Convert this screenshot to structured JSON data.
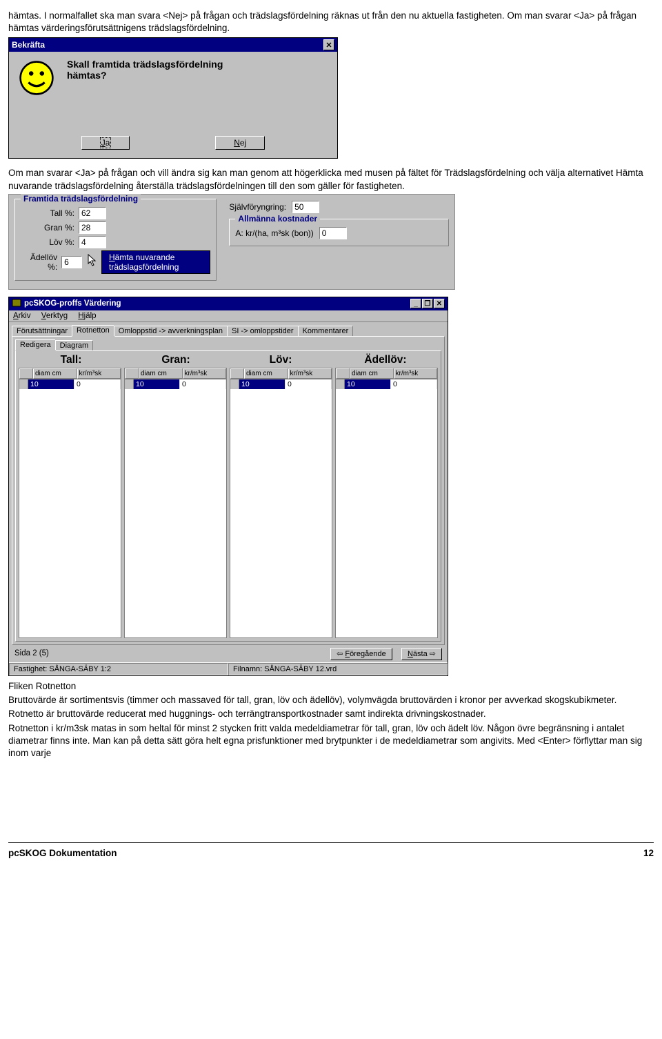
{
  "para1": "hämtas. I normalfallet ska man svara <Nej> på frågan och trädslagsfördelning räknas ut från den nu aktuella fastigheten. Om man svarar <Ja> på frågan hämtas värderingsförutsättnigens trädslagsfördelning.",
  "dialog1": {
    "title": "Bekräfta",
    "message1": "Skall framtida trädslagsfördelning",
    "message2": "hämtas?",
    "yes": "Ja",
    "no": "Nej"
  },
  "para2": "Om man svarar <Ja> på frågan och vill ändra sig kan man genom att högerklicka med musen på fältet för Trädslagsfördelning och välja alternativet Hämta nuvarande trädslagsfördelning återställa trädslagsfördelningen till den som gäller för fastigheten.",
  "form": {
    "group1_title": "Framtida trädslagsfördelning",
    "tall_lbl": "Tall %:",
    "tall_val": "62",
    "gran_lbl": "Gran %:",
    "gran_val": "28",
    "lov_lbl": "Löv %:",
    "lov_val": "4",
    "adel_lbl": "Ädellöv %:",
    "adel_val": "6",
    "sjalv_lbl": "Självföryngring:",
    "sjalv_val": "50",
    "group2_title": "Allmänna kostnader",
    "kost_lbl": "A: kr/(ha, m³sk (bon))",
    "kost_val": "0",
    "ctxmenu": "Hämta nuvarande trädslagsfördelning"
  },
  "bigwin": {
    "title": "pcSKOG-proffs Värdering",
    "menu_arkiv": "Arkiv",
    "menu_verktyg": "Verktyg",
    "menu_hjalp": "Hjälp",
    "tabs1": [
      "Förutsättningar",
      "Rotnetton",
      "Omloppstid -> avverkningsplan",
      "SI -> omloppstider",
      "Kommentarer"
    ],
    "tabs2": [
      "Redigera",
      "Diagram"
    ],
    "cols": [
      "Tall:",
      "Gran:",
      "Löv:",
      "Ädellöv:"
    ],
    "th_diam": "diam cm",
    "th_kr": "kr/m³sk",
    "rows": [
      [
        "10",
        "0"
      ],
      [
        "10",
        "0"
      ],
      [
        "10",
        "0"
      ],
      [
        "10",
        "0"
      ]
    ],
    "page": "Sida 2 (5)",
    "prev": "Föregående",
    "next": "Nästa",
    "status1": "Fastighet: SÅNGA-SÄBY 1:2",
    "status2": "Filnamn: SÅNGA-SÄBY 12.vrd"
  },
  "para3_head": "Fliken Rotnetton",
  "para3_a": "Bruttovärde är sortimentsvis (timmer och massaved för tall, gran, löv och ädellöv), volymvägda bruttovärden i kronor per avverkad skogskubikmeter.",
  "para3_b": "Rotnetto är bruttovärde reducerat med huggnings- och terrängtransportkostnader samt indirekta drivningskostnader.",
  "para3_c": "Rotnetton i kr/m3sk matas in som heltal för minst 2 stycken fritt valda medeldiametrar för tall, gran, löv och ädelt löv. Någon övre begränsning i antalet diametrar finns inte. Man kan på detta sätt göra helt egna prisfunktioner med brytpunkter i de medeldiametrar som angivits. Med <Enter> förflyttar man sig inom varje",
  "footer_left": "pcSKOG Dokumentation",
  "footer_right": "12"
}
